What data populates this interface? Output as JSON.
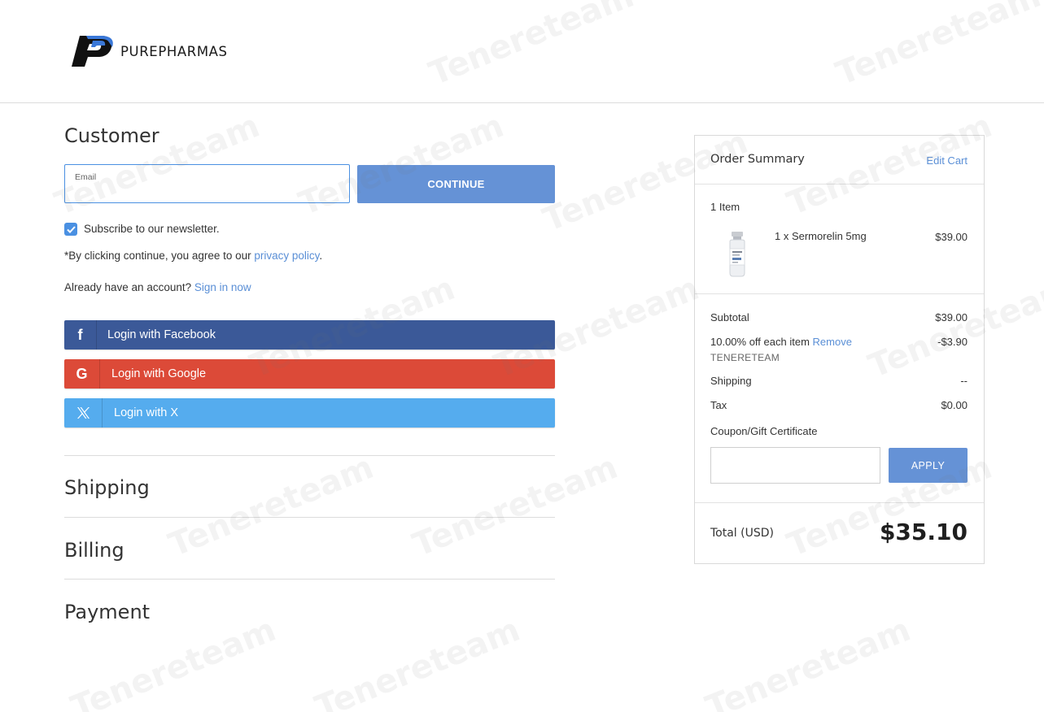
{
  "brand": {
    "name": "PUREPHARMAS"
  },
  "customer": {
    "title": "Customer",
    "email_label": "Email",
    "email_value": "",
    "continue_label": "CONTINUE",
    "newsletter_label": "Subscribe to our newsletter.",
    "newsletter_checked": true,
    "privacy_prefix": "*By clicking continue, you agree to our ",
    "privacy_link": "privacy policy",
    "privacy_suffix": ".",
    "account_prefix": "Already have an account? ",
    "sign_in_link": "Sign in now"
  },
  "social": {
    "facebook": {
      "icon": "facebook-icon",
      "glyph": "f",
      "label": "Login with Facebook",
      "color": "#3b5998"
    },
    "google": {
      "icon": "google-icon",
      "glyph": "G",
      "label": "Login with Google",
      "color": "#dc4a38"
    },
    "x": {
      "icon": "x-icon",
      "glyph": "𝕏",
      "label": "Login with X",
      "color": "#55acee"
    }
  },
  "sections": {
    "shipping": "Shipping",
    "billing": "Billing",
    "payment": "Payment"
  },
  "summary": {
    "title": "Order Summary",
    "edit_cart": "Edit Cart",
    "item_count": "1 Item",
    "items": [
      {
        "name": "1 x Sermorelin 5mg",
        "price": "$39.00",
        "image": "vial-image"
      }
    ],
    "subtotal_label": "Subtotal",
    "subtotal_value": "$39.00",
    "discount_label": "10.00% off each item",
    "discount_remove": "Remove",
    "discount_value": "-$3.90",
    "coupon_code": "TENERETEAM",
    "shipping_label": "Shipping",
    "shipping_value": "--",
    "tax_label": "Tax",
    "tax_value": "$0.00",
    "coupon_label": "Coupon/Gift Certificate",
    "coupon_value": "",
    "apply_label": "APPLY",
    "total_label": "Total (USD)",
    "total_value": "$35.10"
  },
  "watermark": {
    "text": "Tenereteam"
  },
  "colors": {
    "accent": "#6592d6",
    "link": "#5a8fd6",
    "checkbox": "#4a90e2"
  }
}
